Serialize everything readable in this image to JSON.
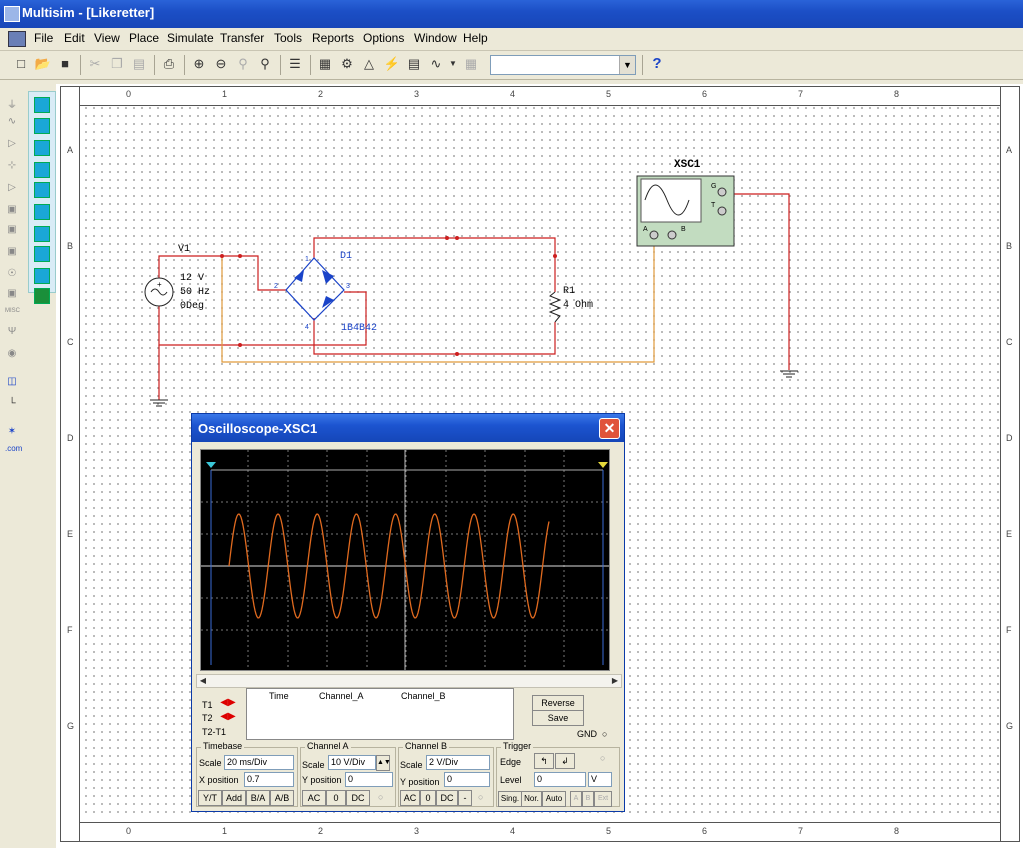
{
  "window": {
    "title": "Multisim - [Likeretter]"
  },
  "menu": [
    "File",
    "Edit",
    "View",
    "Place",
    "Simulate",
    "Transfer",
    "Tools",
    "Reports",
    "Options",
    "Window",
    "Help"
  ],
  "toolbar": {
    "help_glyph": "?"
  },
  "ruler": {
    "cols": [
      "0",
      "1",
      "2",
      "3",
      "4",
      "5",
      "6",
      "7",
      "8"
    ],
    "rows": [
      "A",
      "B",
      "C",
      "D",
      "E",
      "F",
      "G"
    ]
  },
  "palette": {
    "misc": "MISC",
    "com": ".com"
  },
  "schematic": {
    "v1": {
      "name": "V1",
      "voltage": "12 V",
      "freq": "50 Hz",
      "phase": "0Deg"
    },
    "d1": {
      "name": "D1",
      "part": "1B4B42",
      "pins": [
        "1",
        "2",
        "3",
        "4"
      ]
    },
    "r1": {
      "name": "R1",
      "value": "4 Ohm"
    },
    "xsc1": {
      "name": "XSC1",
      "pin_g": "G",
      "pin_t": "T",
      "pin_a": "A",
      "pin_b": "B"
    }
  },
  "oscilloscope": {
    "title": "Oscilloscope-XSC1",
    "readout": {
      "t1": "T1",
      "t2": "T2",
      "t2t1": "T2-T1",
      "col_time": "Time",
      "col_a": "Channel_A",
      "col_b": "Channel_B"
    },
    "reverse": "Reverse",
    "save": "Save",
    "gnd": "GND",
    "timebase": {
      "title": "Timebase",
      "scale_label": "Scale",
      "scale": "20 ms/Div",
      "xpos_label": "X position",
      "xpos": "0.7",
      "modes": [
        "Y/T",
        "Add",
        "B/A",
        "A/B"
      ]
    },
    "channel_a": {
      "title": "Channel A",
      "scale_label": "Scale",
      "scale": "10  V/Div",
      "ypos_label": "Y position",
      "ypos": "0",
      "coupling": [
        "AC",
        "0",
        "DC"
      ]
    },
    "channel_b": {
      "title": "Channel B",
      "scale_label": "Scale",
      "scale": "2  V/Div",
      "ypos_label": "Y position",
      "ypos": "0",
      "coupling": [
        "AC",
        "0",
        "DC",
        "-"
      ]
    },
    "trigger": {
      "title": "Trigger",
      "edge_label": "Edge",
      "level_label": "Level",
      "level": "0",
      "unit": "V",
      "modes": [
        "Sing.",
        "Nor.",
        "Auto"
      ],
      "src": [
        "A",
        "B",
        "Ext"
      ]
    }
  },
  "colors": {
    "wire_red": "#cc1f1f",
    "wire_orange": "#e09a3b",
    "trace": "#e06a1f",
    "diode_blue": "#1a43c8"
  }
}
